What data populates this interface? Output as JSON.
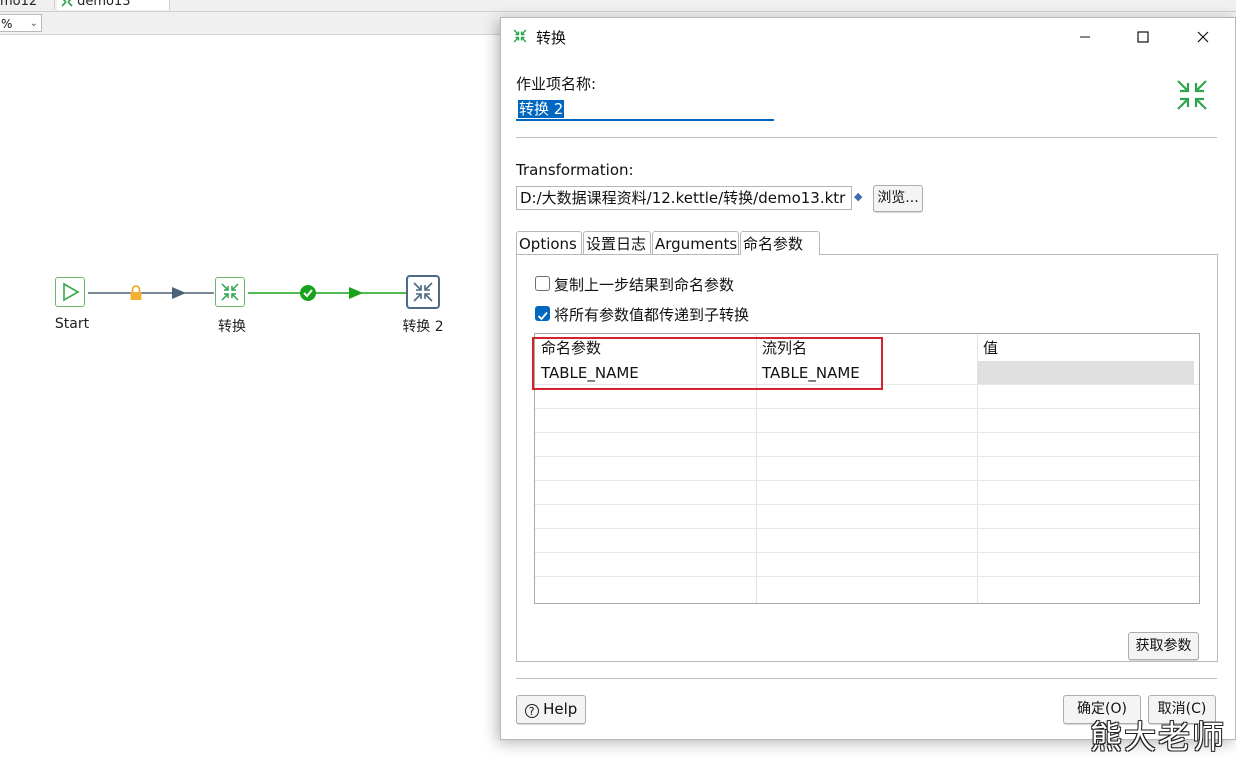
{
  "app": {
    "tabs": [
      "mo12",
      "demo13"
    ],
    "zoom": "%"
  },
  "canvas": {
    "nodes": [
      {
        "label": "Start",
        "icon": "play-icon"
      },
      {
        "label": "转换",
        "icon": "transformation-icon"
      },
      {
        "label": "转换 2",
        "icon": "transformation-icon"
      }
    ],
    "hops": [
      {
        "icon": "lock-icon",
        "color": "#f0a020"
      },
      {
        "icon": "check-circle-icon",
        "color": "#19a31a"
      }
    ]
  },
  "dialog": {
    "title": "转换",
    "job_entry_label": "作业项名称:",
    "job_entry_value": "转换 2",
    "transformation_label": "Transformation:",
    "transformation_path": "D:/大数据课程资料/12.kettle/转换/demo13.ktr",
    "browse_label": "浏览...",
    "tabs": [
      "Options",
      "设置日志",
      "Arguments",
      "命名参数"
    ],
    "active_tab": "命名参数",
    "checkbox_copy": {
      "label": "复制上一步结果到命名参数",
      "checked": false
    },
    "checkbox_pass_all": {
      "label": "将所有参数值都传递到子转换",
      "checked": true
    },
    "table": {
      "columns": [
        "命名参数",
        "流列名",
        "值"
      ],
      "rows": [
        [
          "TABLE_NAME",
          "TABLE_NAME",
          ""
        ]
      ]
    },
    "get_params_label": "获取参数",
    "help_label": "Help",
    "ok_label": "确定(O)",
    "cancel_label": "取消(C)",
    "accent_color": "#0067c0",
    "highlight_color": "#d3242b"
  },
  "watermark": "熊大老师"
}
